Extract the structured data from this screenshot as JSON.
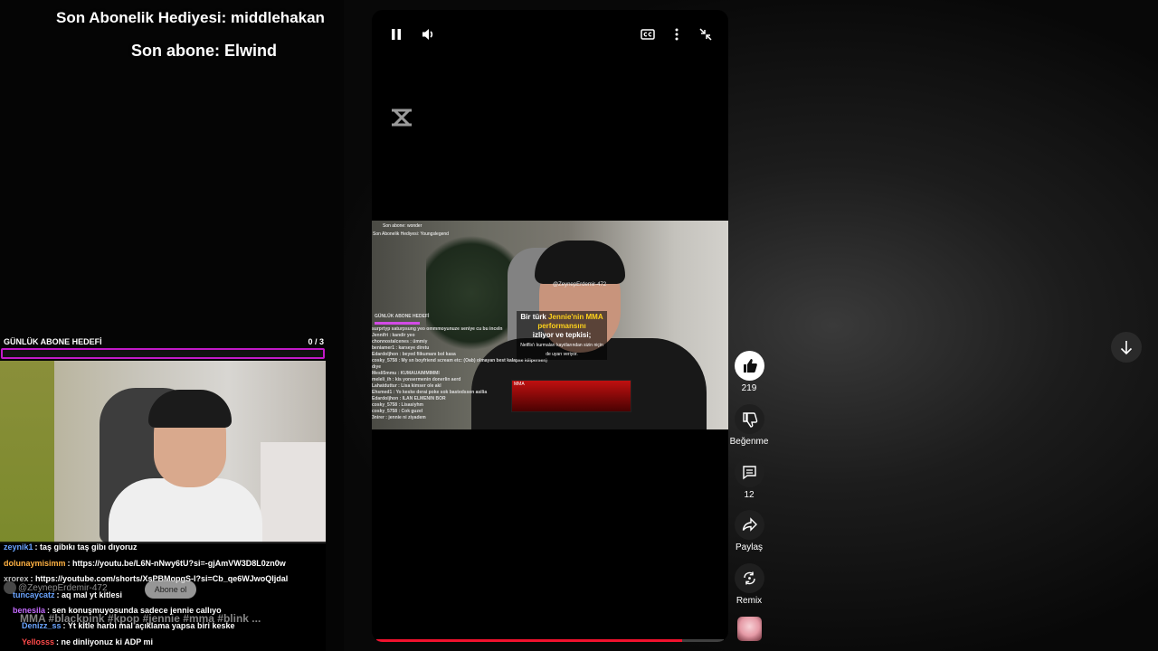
{
  "overlay": {
    "last_gift": "Son Abonelik Hediyesi: middlehakan",
    "last_sub": "Son abone: Elwind",
    "goal_label": "GÜNLÜK ABONE HEDEFİ",
    "goal_count": "0  / 3",
    "goal_progress": 0
  },
  "chat": [
    {
      "user": "zeynik1",
      "color": "#6aa4ff",
      "text": ": taş gibıkı taş gibı dıyoruz"
    },
    {
      "user": "dolunaymisimm",
      "color": "#ffb142",
      "text": ": https://youtu.be/L6N-nNwy6tU?si=-gjAmVW3D8L0zn0w"
    },
    {
      "user": "xrorex",
      "color": "#bfbfbf",
      "text": ": https://youtube.com/shorts/XsPBMopgS-I?si=Cb_qe6WJwoQljdal"
    },
    {
      "user": "tuncaycatz",
      "color": "#6aa4ff",
      "text": ": aq mal yt kitlesi"
    },
    {
      "user": "benesila",
      "color": "#c56bff",
      "text": ": sen konuşmuyosunda sadece jennie callıyo"
    },
    {
      "user": "Denizz_ss",
      "color": "#6aa4ff",
      "text": ": Yt kitle harbi mal açıklama yapsa biri keske"
    },
    {
      "user": "Yellosss",
      "color": "#ff4a4a",
      "text": ": ne dinliyonuz ki ADP mi"
    }
  ],
  "channel": {
    "handle": "@ZeynepErdemir-472",
    "subscribe": "Abone ol",
    "hashtags": "MMA #blackpink #kpop #jennie #mma #blink ..."
  },
  "inner_video": {
    "sub_line": "Son abone: wonder",
    "gift_line": "Son Abonelik Hediyesi: Youngslegend",
    "watermark": "@ZeynepErdemir-472",
    "caption_1": "Bir türk ",
    "caption_highlight": "Jennie'nin MMA performansını",
    "caption_2": "izliyor ve tepkisi;",
    "caption_small": "Netflix'ı kurmaları kayıtlarından sizin niçin de uyarı veriyor.",
    "stage_label": "MMA",
    "panel_label": "GÜNLÜK ABONE HEDEFİ",
    "panel_lines": [
      "surprtyp saturpsung yeo ommmoyunuze seniye cu bu inceln",
      "Jennifri : kandir yeo",
      "chonnostalcenes : ümmiy",
      "beniamer1 : karseye diretu",
      "Edardoljhon : beyed fiikumanı bol kasa",
      "cosky_5758 : My sn boyfriend scream etc: (Oab) olmayan best kalapse kilipersen)",
      "dıye",
      "Mesli5mmu : KUMAUAIMMIMMI",
      "meleli_ih : kis yonsermenin donerlin aerd",
      "Lahatduttur : Lisa kimser ole akl",
      "Ehsmed1 : Yo keske derai poke sok bastedssen asilia",
      "Edardoljhon : ILAN ELMENIN BOR",
      "cosky_5758 : Lisasiyhm",
      "cosky_5758 : Cok guzel",
      "3nirer : jennie ni ziyadem"
    ]
  },
  "playback": {
    "progress": 0.88
  },
  "actions": {
    "like_count": "219",
    "dislike_label": "Beğenme",
    "comment_count": "12",
    "share_label": "Paylaş",
    "remix_label": "Remix"
  }
}
